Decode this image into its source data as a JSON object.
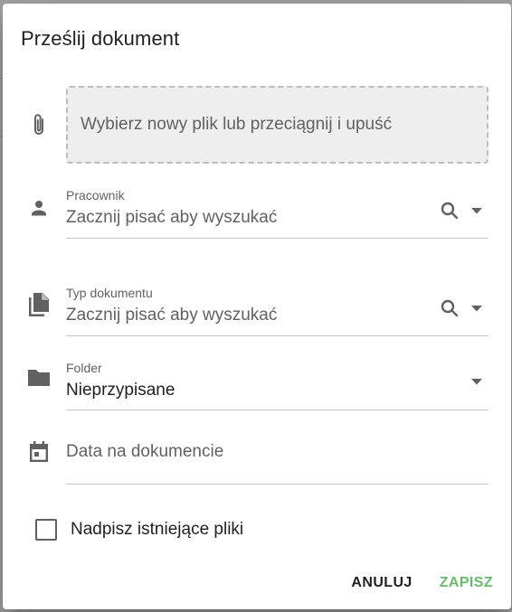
{
  "dialog": {
    "title": "Prześlij dokument"
  },
  "upload": {
    "prompt": "Wybierz nowy plik lub przeciągnij i upuść"
  },
  "fields": {
    "employee": {
      "label": "Pracownik",
      "placeholder": "Zacznij pisać aby wyszukać"
    },
    "document_type": {
      "label": "Typ dokumentu",
      "placeholder": "Zacznij pisać aby wyszukać"
    },
    "folder": {
      "label": "Folder",
      "value": "Nieprzypisane"
    },
    "document_date": {
      "placeholder": "Data na dokumencie"
    }
  },
  "overwrite": {
    "label": "Nadpisz istniejące pliki",
    "checked": false
  },
  "actions": {
    "cancel_label": "ANULUJ",
    "save_label": "ZAPISZ"
  },
  "colors": {
    "accent": "#66bb6a",
    "icon": "#616161",
    "text": "#212121"
  },
  "icons": {
    "upload": "paperclip-icon",
    "employee": "person-icon",
    "document_type": "file-copy-icon",
    "folder": "folder-icon",
    "date": "calendar-icon",
    "search": "search-icon",
    "dropdown": "caret-down-icon"
  }
}
